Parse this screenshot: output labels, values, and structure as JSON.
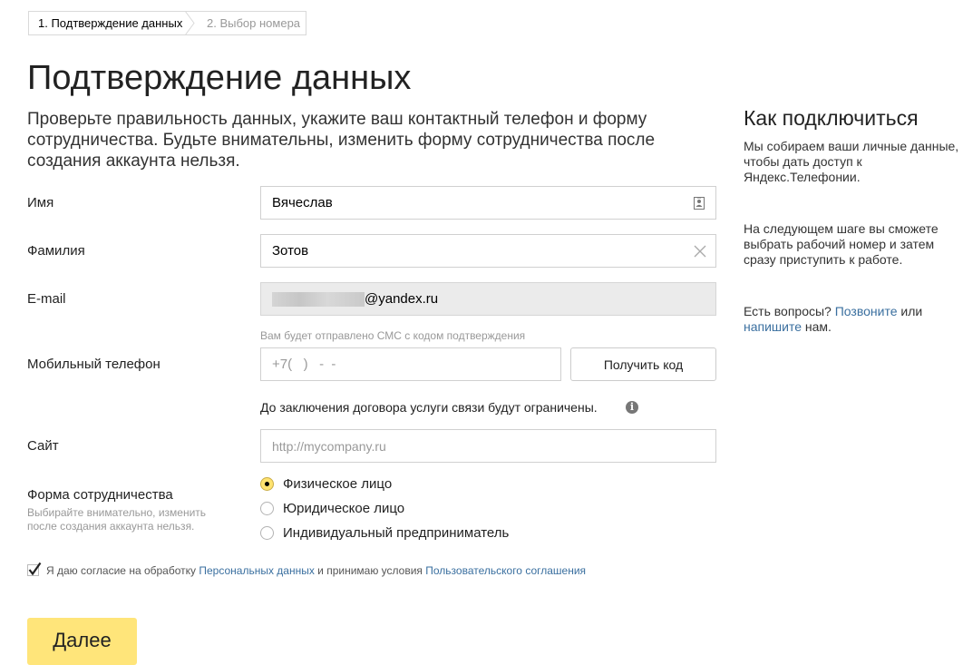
{
  "breadcrumb": {
    "step1": "1. Подтверждение данных",
    "step2": "2. Выбор номера"
  },
  "page_title": "Подтверждение данных",
  "intro": "Проверьте правильность данных, укажите ваш контактный телефон и форму сотрудничества. Будьте внимательны, изменить форму сотрудничества после создания аккаунта нельзя.",
  "form": {
    "name_label": "Имя",
    "name_value": "Вячеслав",
    "surname_label": "Фамилия",
    "surname_value": "Зотов",
    "email_label": "E-mail",
    "email_domain": "@yandex.ru",
    "sms_hint": "Вам будет отправлено СМС с кодом подтверждения",
    "phone_label": "Мобильный телефон",
    "phone_placeholder": "+7(   )   -  -",
    "get_code_button": "Получить код",
    "restriction_note": "До заключения договора услуги связи будут ограничены.",
    "site_label": "Сайт",
    "site_placeholder": "http://mycompany.ru",
    "cooperation_label": "Форма сотрудничества",
    "cooperation_hint": "Выбирайте внимательно, изменить после создания аккаунта нельзя.",
    "cooperation_options": [
      "Физическое лицо",
      "Юридическое лицо",
      "Индивидуальный предприниматель"
    ],
    "cooperation_selected": "Физическое лицо",
    "consent_text_1": "Я даю согласие на обработку ",
    "consent_link_1": "Персональных данных",
    "consent_text_2": " и принимаю условия ",
    "consent_link_2": "Пользовательского соглашения",
    "consent_checked": true,
    "next_button": "Далее"
  },
  "sidebar": {
    "title": "Как подключиться",
    "p1": "Мы собираем ваши личные данные, чтобы дать доступ к Яндекс.Телефонии.",
    "p2": "На следующем шаге вы сможете выбрать рабочий номер и затем сразу приступить к работе.",
    "p3_text_1": "Есть вопросы? ",
    "p3_link_1": "Позвоните",
    "p3_text_2": " или ",
    "p3_link_2": "напишите",
    "p3_text_3": " нам."
  },
  "colors": {
    "accent_yellow": "#ffe57a",
    "link_blue": "#3a6f9f"
  }
}
